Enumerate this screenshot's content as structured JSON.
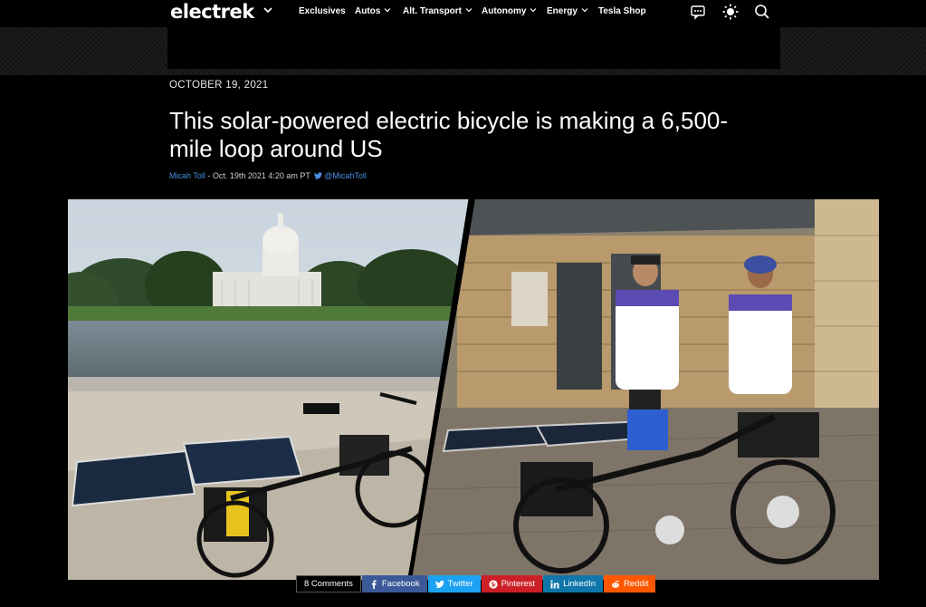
{
  "nav": {
    "logo": "electrek",
    "items": [
      {
        "label": "Exclusives",
        "dropdown": false
      },
      {
        "label": "Autos",
        "dropdown": true
      },
      {
        "label": "Alt. Transport",
        "dropdown": true
      },
      {
        "label": "Autonomy",
        "dropdown": true
      },
      {
        "label": "Energy",
        "dropdown": true
      },
      {
        "label": "Tesla Shop",
        "dropdown": false
      }
    ],
    "icons": [
      "chat-icon",
      "brightness-icon",
      "search-icon"
    ]
  },
  "article": {
    "date": "OCTOBER 19, 2021",
    "title": "This solar-powered electric bicycle is making a 6,500-mile loop around US",
    "author": "Micah Toll",
    "timestamp": " - Oct. 19th 2021 4:20 am PT ",
    "twitter_handle": "@MicahToll"
  },
  "share": {
    "comments": "8 Comments",
    "facebook": "Facebook",
    "twitter": "Twitter",
    "pinterest": "Pinterest",
    "linkedin": "LinkedIn",
    "reddit": "Reddit"
  },
  "colors": {
    "background": "#000000",
    "link": "#4a90e2",
    "facebook": "#3b5998",
    "twitter": "#1da1f2",
    "pinterest": "#cb2027",
    "linkedin": "#0e76a8",
    "reddit": "#ff5700"
  }
}
